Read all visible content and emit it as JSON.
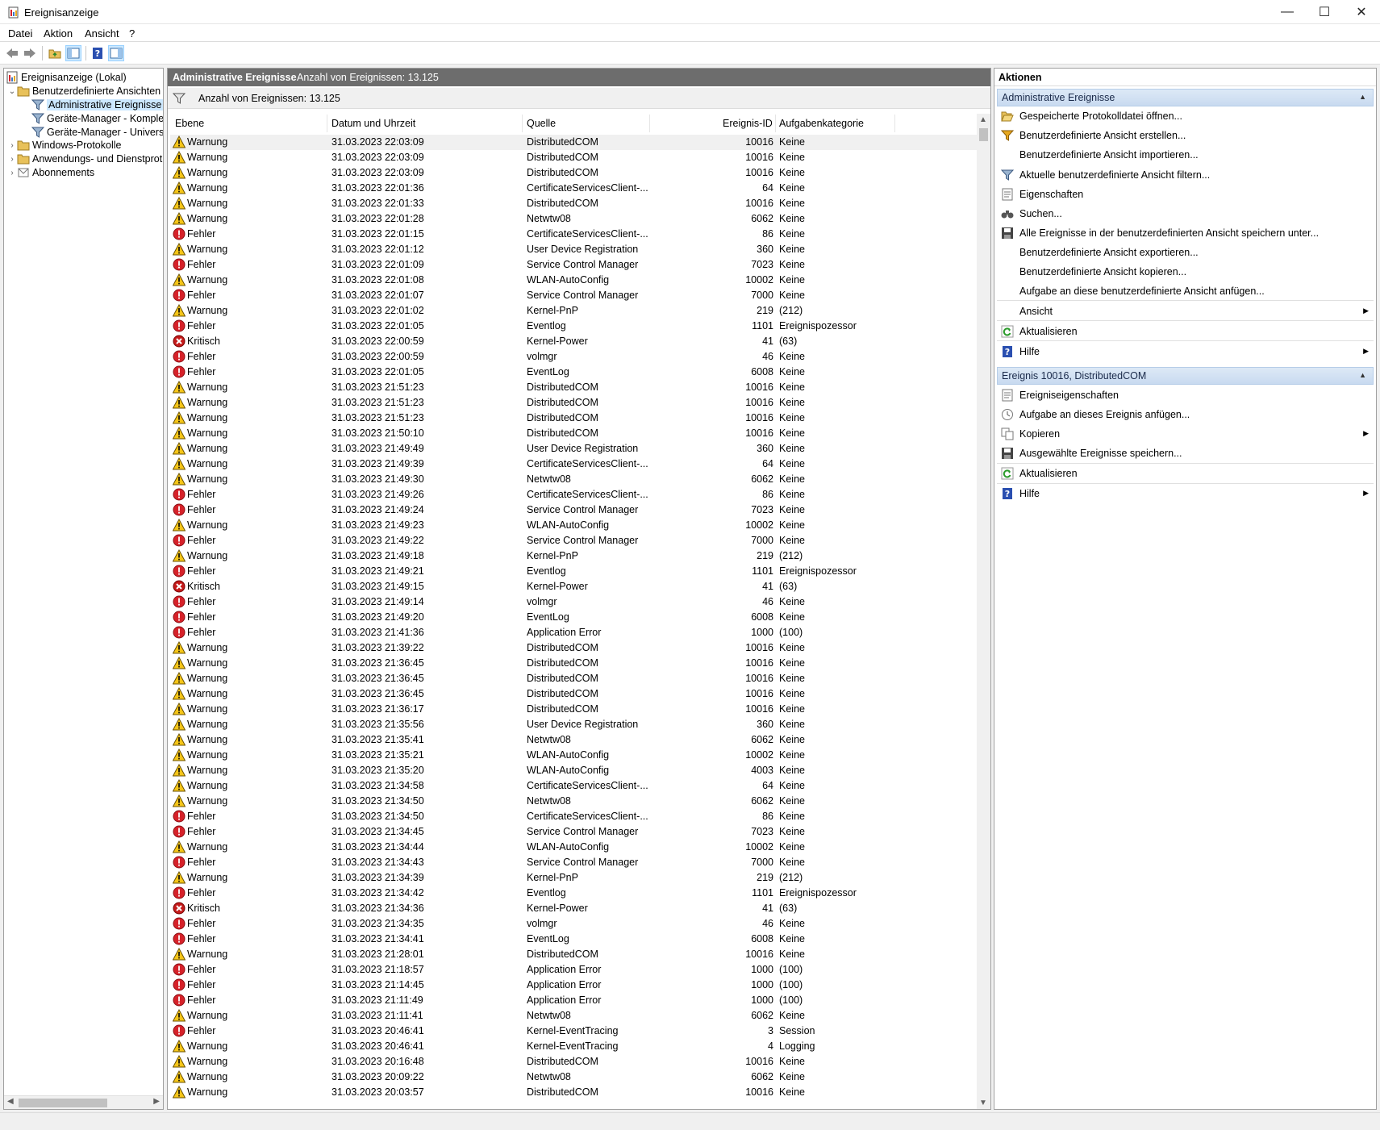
{
  "window": {
    "title": "Ereignisanzeige"
  },
  "menu": [
    "Datei",
    "Aktion",
    "Ansicht",
    "?"
  ],
  "tree": [
    {
      "label": "Ereignisanzeige (Lokal)",
      "icon": "event-viewer-icon",
      "level": 0
    },
    {
      "label": "Benutzerdefinierte Ansichten",
      "icon": "folder-icon",
      "level": 1,
      "expanded": true
    },
    {
      "label": "Administrative Ereignisse",
      "icon": "filter-icon",
      "level": 2,
      "selected": true
    },
    {
      "label": "Geräte-Manager - Komple",
      "icon": "filter-icon",
      "level": 2
    },
    {
      "label": "Geräte-Manager - Univers",
      "icon": "filter-icon",
      "level": 2
    },
    {
      "label": "Windows-Protokolle",
      "icon": "folder-icon",
      "level": 1
    },
    {
      "label": "Anwendungs- und Dienstprot",
      "icon": "folder-icon",
      "level": 1
    },
    {
      "label": "Abonnements",
      "icon": "subscription-icon",
      "level": 1
    }
  ],
  "middle": {
    "header_title": "Administrative Ereignisse",
    "header_count": "Anzahl von Ereignissen: 13.125",
    "filter_text": "Anzahl von Ereignissen: 13.125",
    "columns": [
      "Ebene",
      "Datum und Uhrzeit",
      "Quelle",
      "Ereignis-ID",
      "Aufgabenkategorie"
    ],
    "rows": [
      [
        "Warnung",
        "31.03.2023 22:03:09",
        "DistributedCOM",
        "10016",
        "Keine"
      ],
      [
        "Warnung",
        "31.03.2023 22:03:09",
        "DistributedCOM",
        "10016",
        "Keine"
      ],
      [
        "Warnung",
        "31.03.2023 22:03:09",
        "DistributedCOM",
        "10016",
        "Keine"
      ],
      [
        "Warnung",
        "31.03.2023 22:01:36",
        "CertificateServicesClient-...",
        "64",
        "Keine"
      ],
      [
        "Warnung",
        "31.03.2023 22:01:33",
        "DistributedCOM",
        "10016",
        "Keine"
      ],
      [
        "Warnung",
        "31.03.2023 22:01:28",
        "Netwtw08",
        "6062",
        "Keine"
      ],
      [
        "Fehler",
        "31.03.2023 22:01:15",
        "CertificateServicesClient-...",
        "86",
        "Keine"
      ],
      [
        "Warnung",
        "31.03.2023 22:01:12",
        "User Device Registration",
        "360",
        "Keine"
      ],
      [
        "Fehler",
        "31.03.2023 22:01:09",
        "Service Control Manager",
        "7023",
        "Keine"
      ],
      [
        "Warnung",
        "31.03.2023 22:01:08",
        "WLAN-AutoConfig",
        "10002",
        "Keine"
      ],
      [
        "Fehler",
        "31.03.2023 22:01:07",
        "Service Control Manager",
        "7000",
        "Keine"
      ],
      [
        "Warnung",
        "31.03.2023 22:01:02",
        "Kernel-PnP",
        "219",
        "(212)"
      ],
      [
        "Fehler",
        "31.03.2023 22:01:05",
        "Eventlog",
        "1101",
        "Ereignispozessor"
      ],
      [
        "Kritisch",
        "31.03.2023 22:00:59",
        "Kernel-Power",
        "41",
        "(63)"
      ],
      [
        "Fehler",
        "31.03.2023 22:00:59",
        "volmgr",
        "46",
        "Keine"
      ],
      [
        "Fehler",
        "31.03.2023 22:01:05",
        "EventLog",
        "6008",
        "Keine"
      ],
      [
        "Warnung",
        "31.03.2023 21:51:23",
        "DistributedCOM",
        "10016",
        "Keine"
      ],
      [
        "Warnung",
        "31.03.2023 21:51:23",
        "DistributedCOM",
        "10016",
        "Keine"
      ],
      [
        "Warnung",
        "31.03.2023 21:51:23",
        "DistributedCOM",
        "10016",
        "Keine"
      ],
      [
        "Warnung",
        "31.03.2023 21:50:10",
        "DistributedCOM",
        "10016",
        "Keine"
      ],
      [
        "Warnung",
        "31.03.2023 21:49:49",
        "User Device Registration",
        "360",
        "Keine"
      ],
      [
        "Warnung",
        "31.03.2023 21:49:39",
        "CertificateServicesClient-...",
        "64",
        "Keine"
      ],
      [
        "Warnung",
        "31.03.2023 21:49:30",
        "Netwtw08",
        "6062",
        "Keine"
      ],
      [
        "Fehler",
        "31.03.2023 21:49:26",
        "CertificateServicesClient-...",
        "86",
        "Keine"
      ],
      [
        "Fehler",
        "31.03.2023 21:49:24",
        "Service Control Manager",
        "7023",
        "Keine"
      ],
      [
        "Warnung",
        "31.03.2023 21:49:23",
        "WLAN-AutoConfig",
        "10002",
        "Keine"
      ],
      [
        "Fehler",
        "31.03.2023 21:49:22",
        "Service Control Manager",
        "7000",
        "Keine"
      ],
      [
        "Warnung",
        "31.03.2023 21:49:18",
        "Kernel-PnP",
        "219",
        "(212)"
      ],
      [
        "Fehler",
        "31.03.2023 21:49:21",
        "Eventlog",
        "1101",
        "Ereignispozessor"
      ],
      [
        "Kritisch",
        "31.03.2023 21:49:15",
        "Kernel-Power",
        "41",
        "(63)"
      ],
      [
        "Fehler",
        "31.03.2023 21:49:14",
        "volmgr",
        "46",
        "Keine"
      ],
      [
        "Fehler",
        "31.03.2023 21:49:20",
        "EventLog",
        "6008",
        "Keine"
      ],
      [
        "Fehler",
        "31.03.2023 21:41:36",
        "Application Error",
        "1000",
        "(100)"
      ],
      [
        "Warnung",
        "31.03.2023 21:39:22",
        "DistributedCOM",
        "10016",
        "Keine"
      ],
      [
        "Warnung",
        "31.03.2023 21:36:45",
        "DistributedCOM",
        "10016",
        "Keine"
      ],
      [
        "Warnung",
        "31.03.2023 21:36:45",
        "DistributedCOM",
        "10016",
        "Keine"
      ],
      [
        "Warnung",
        "31.03.2023 21:36:45",
        "DistributedCOM",
        "10016",
        "Keine"
      ],
      [
        "Warnung",
        "31.03.2023 21:36:17",
        "DistributedCOM",
        "10016",
        "Keine"
      ],
      [
        "Warnung",
        "31.03.2023 21:35:56",
        "User Device Registration",
        "360",
        "Keine"
      ],
      [
        "Warnung",
        "31.03.2023 21:35:41",
        "Netwtw08",
        "6062",
        "Keine"
      ],
      [
        "Warnung",
        "31.03.2023 21:35:21",
        "WLAN-AutoConfig",
        "10002",
        "Keine"
      ],
      [
        "Warnung",
        "31.03.2023 21:35:20",
        "WLAN-AutoConfig",
        "4003",
        "Keine"
      ],
      [
        "Warnung",
        "31.03.2023 21:34:58",
        "CertificateServicesClient-...",
        "64",
        "Keine"
      ],
      [
        "Warnung",
        "31.03.2023 21:34:50",
        "Netwtw08",
        "6062",
        "Keine"
      ],
      [
        "Fehler",
        "31.03.2023 21:34:50",
        "CertificateServicesClient-...",
        "86",
        "Keine"
      ],
      [
        "Fehler",
        "31.03.2023 21:34:45",
        "Service Control Manager",
        "7023",
        "Keine"
      ],
      [
        "Warnung",
        "31.03.2023 21:34:44",
        "WLAN-AutoConfig",
        "10002",
        "Keine"
      ],
      [
        "Fehler",
        "31.03.2023 21:34:43",
        "Service Control Manager",
        "7000",
        "Keine"
      ],
      [
        "Warnung",
        "31.03.2023 21:34:39",
        "Kernel-PnP",
        "219",
        "(212)"
      ],
      [
        "Fehler",
        "31.03.2023 21:34:42",
        "Eventlog",
        "1101",
        "Ereignispozessor"
      ],
      [
        "Kritisch",
        "31.03.2023 21:34:36",
        "Kernel-Power",
        "41",
        "(63)"
      ],
      [
        "Fehler",
        "31.03.2023 21:34:35",
        "volmgr",
        "46",
        "Keine"
      ],
      [
        "Fehler",
        "31.03.2023 21:34:41",
        "EventLog",
        "6008",
        "Keine"
      ],
      [
        "Warnung",
        "31.03.2023 21:28:01",
        "DistributedCOM",
        "10016",
        "Keine"
      ],
      [
        "Fehler",
        "31.03.2023 21:18:57",
        "Application Error",
        "1000",
        "(100)"
      ],
      [
        "Fehler",
        "31.03.2023 21:14:45",
        "Application Error",
        "1000",
        "(100)"
      ],
      [
        "Fehler",
        "31.03.2023 21:11:49",
        "Application Error",
        "1000",
        "(100)"
      ],
      [
        "Warnung",
        "31.03.2023 21:11:41",
        "Netwtw08",
        "6062",
        "Keine"
      ],
      [
        "Fehler",
        "31.03.2023 20:46:41",
        "Kernel-EventTracing",
        "3",
        "Session"
      ],
      [
        "Warnung",
        "31.03.2023 20:46:41",
        "Kernel-EventTracing",
        "4",
        "Logging"
      ],
      [
        "Warnung",
        "31.03.2023 20:16:48",
        "DistributedCOM",
        "10016",
        "Keine"
      ],
      [
        "Warnung",
        "31.03.2023 20:09:22",
        "Netwtw08",
        "6062",
        "Keine"
      ],
      [
        "Warnung",
        "31.03.2023 20:03:57",
        "DistributedCOM",
        "10016",
        "Keine"
      ]
    ]
  },
  "actions": {
    "title": "Aktionen",
    "section1": {
      "title": "Administrative Ereignisse",
      "items": [
        {
          "label": "Gespeicherte Protokolldatei öffnen...",
          "icon": "open-folder-icon"
        },
        {
          "label": "Benutzerdefinierte Ansicht erstellen...",
          "icon": "filter-create-icon"
        },
        {
          "label": "Benutzerdefinierte Ansicht importieren...",
          "icon": ""
        },
        {
          "label": "Aktuelle benutzerdefinierte Ansicht filtern...",
          "icon": "filter-icon"
        },
        {
          "label": "Eigenschaften",
          "icon": "properties-icon"
        },
        {
          "label": "Suchen...",
          "icon": "binoculars-icon"
        },
        {
          "label": "Alle Ereignisse in der benutzerdefinierten Ansicht speichern unter...",
          "icon": "save-icon"
        },
        {
          "label": "Benutzerdefinierte Ansicht exportieren...",
          "icon": ""
        },
        {
          "label": "Benutzerdefinierte Ansicht kopieren...",
          "icon": ""
        },
        {
          "label": "Aufgabe an diese benutzerdefinierte Ansicht anfügen...",
          "icon": ""
        },
        {
          "label": "Ansicht",
          "icon": "",
          "submenu": true
        },
        {
          "label": "Aktualisieren",
          "icon": "refresh-icon"
        },
        {
          "label": "Hilfe",
          "icon": "help-icon",
          "submenu": true
        }
      ]
    },
    "section2": {
      "title": "Ereignis 10016, DistributedCOM",
      "items": [
        {
          "label": "Ereigniseigenschaften",
          "icon": "properties-icon"
        },
        {
          "label": "Aufgabe an dieses Ereignis anfügen...",
          "icon": "task-icon"
        },
        {
          "label": "Kopieren",
          "icon": "copy-icon",
          "submenu": true
        },
        {
          "label": "Ausgewählte Ereignisse speichern...",
          "icon": "save-icon"
        },
        {
          "label": "Aktualisieren",
          "icon": "refresh-icon"
        },
        {
          "label": "Hilfe",
          "icon": "help-icon",
          "submenu": true
        }
      ]
    }
  },
  "colors": {
    "warning": "#f5c518",
    "error": "#d6222a",
    "critical": "#c41a1a",
    "header_gray": "#6d6d6d",
    "selection": "#cce8ff"
  }
}
